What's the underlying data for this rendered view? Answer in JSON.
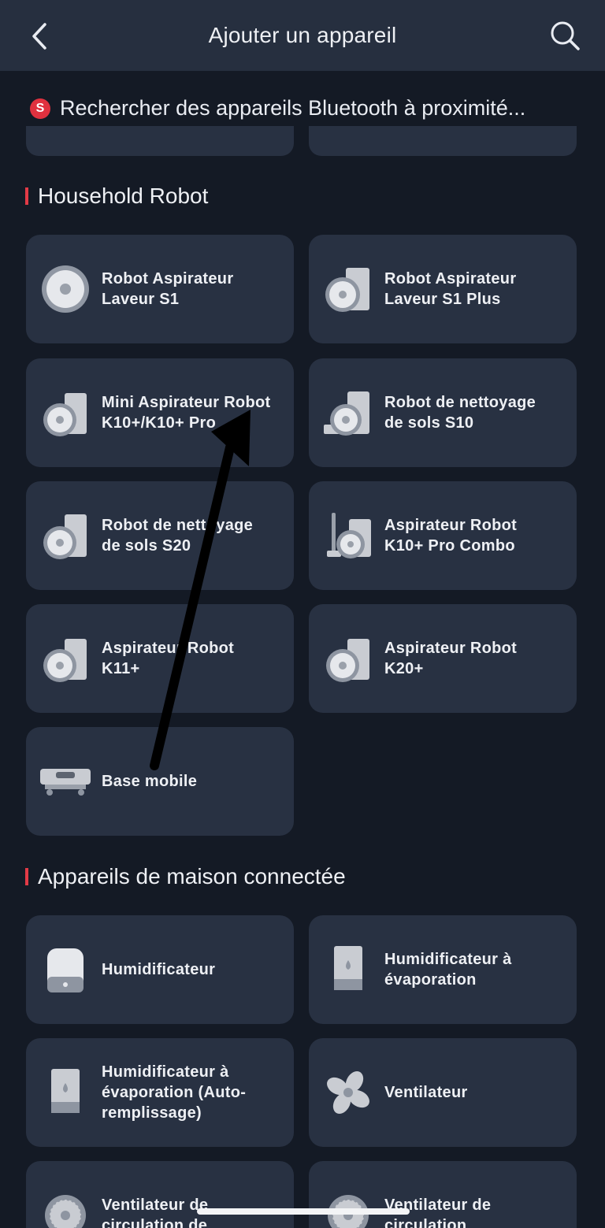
{
  "header": {
    "title": "Ajouter un appareil"
  },
  "bluetooth": {
    "badge": "S",
    "text": "Rechercher des appareils Bluetooth à proximité..."
  },
  "sections": {
    "household": {
      "title": "Household Robot"
    },
    "smart_home": {
      "title": "Appareils de maison connectée"
    }
  },
  "devices": {
    "s1": "Robot Aspirateur\nLaveur S1",
    "s1plus": "Robot Aspirateur\nLaveur S1 Plus",
    "k10": "Mini Aspirateur Robot\nK10+/K10+ Pro",
    "s10": "Robot de nettoyage\nde sols S10",
    "s20": "Robot de nettoyage\nde sols S20",
    "k10combo": "Aspirateur Robot\nK10+ Pro Combo",
    "k11": "Aspirateur Robot\nK11+",
    "k20": "Aspirateur Robot\nK20+",
    "base": "Base mobile",
    "humidifier": "Humidificateur",
    "evap_humidifier": "Humidificateur à\névaporation",
    "evap_auto": "Humidificateur à\névaporation (Auto-\nremplissage)",
    "fan": "Ventilateur",
    "circ_fan1": "Ventilateur de\ncirculation de",
    "circ_fan2": "Ventilateur de\ncirculation"
  },
  "colors": {
    "accent": "#e23a46",
    "card": "#283142",
    "background": "#141a25",
    "header": "#262f3f"
  }
}
